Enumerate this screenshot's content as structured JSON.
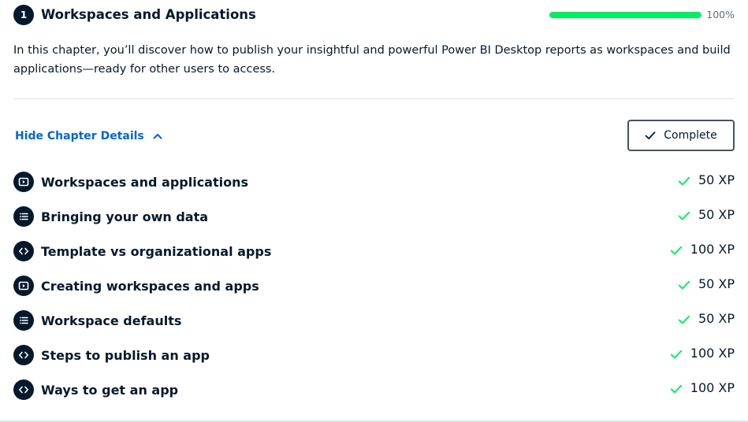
{
  "chapter": {
    "number": "1",
    "title": "Workspaces and Applications",
    "progress_percent": 100,
    "progress_label": "100%",
    "description": "In this chapter, you’ll discover how to publish your insightful and powerful Power BI Desktop reports as workspaces and build applications—ready for other users to access.",
    "toggle_label": "Hide Chapter Details",
    "complete_label": "Complete"
  },
  "colors": {
    "navy": "#05192d",
    "link_blue": "#0065d1",
    "progress_green": "#03ef62",
    "check_green": "#03ef62"
  },
  "exercises": [
    {
      "type": "video",
      "icon": "play-icon",
      "title": "Workspaces and applications",
      "xp": "50 XP",
      "completed": true
    },
    {
      "type": "multiple-choice",
      "icon": "list-icon",
      "title": "Bringing your own data",
      "xp": "50 XP",
      "completed": true
    },
    {
      "type": "exercise",
      "icon": "code-icon",
      "title": "Template vs organizational apps",
      "xp": "100 XP",
      "completed": true
    },
    {
      "type": "video",
      "icon": "play-icon",
      "title": "Creating workspaces and apps",
      "xp": "50 XP",
      "completed": true
    },
    {
      "type": "multiple-choice",
      "icon": "list-icon",
      "title": "Workspace defaults",
      "xp": "50 XP",
      "completed": true
    },
    {
      "type": "exercise",
      "icon": "code-icon",
      "title": "Steps to publish an app",
      "xp": "100 XP",
      "completed": true
    },
    {
      "type": "exercise",
      "icon": "code-icon",
      "title": "Ways to get an app",
      "xp": "100 XP",
      "completed": true
    }
  ]
}
